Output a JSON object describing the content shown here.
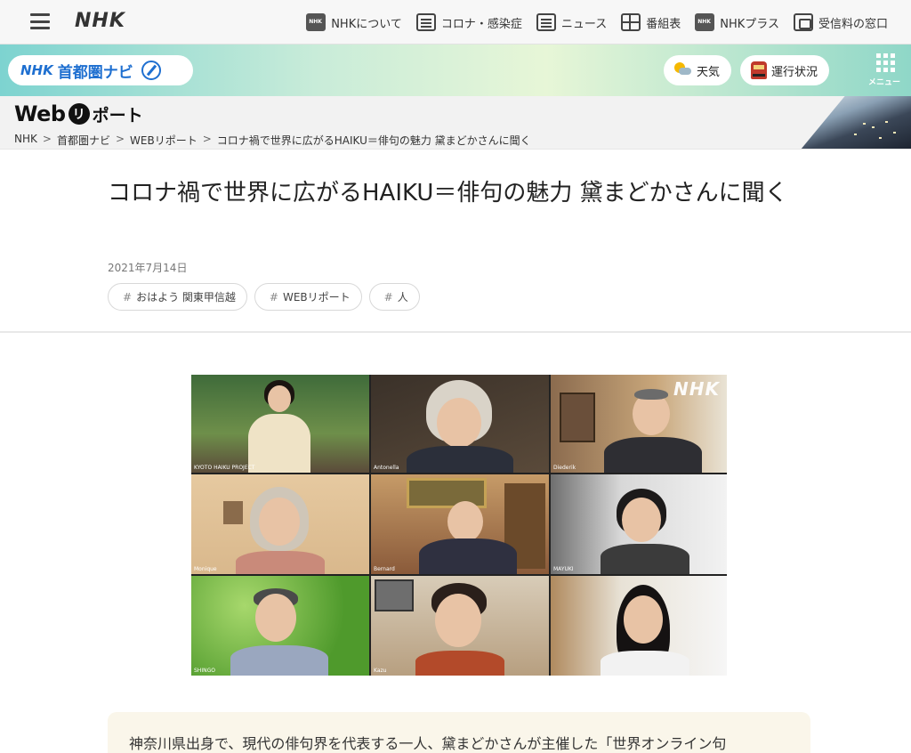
{
  "header": {
    "logo": "NHK",
    "nav": [
      {
        "label": "NHKについて",
        "icon": "nhk-about-icon"
      },
      {
        "label": "コロナ・感染症",
        "icon": "corona-icon"
      },
      {
        "label": "ニュース",
        "icon": "news-icon"
      },
      {
        "label": "番組表",
        "icon": "program-table-icon"
      },
      {
        "label": "NHKプラス",
        "icon": "nhk-plus-icon"
      },
      {
        "label": "受信料の窓口",
        "icon": "reception-fee-icon"
      }
    ]
  },
  "area_nav": {
    "brand": "NHK",
    "area_name": "首都圏ナビ",
    "weather_label": "天気",
    "traffic_label": "運行状況",
    "menu_label": "メニュー"
  },
  "section": {
    "logo_web": "Web",
    "logo_circle": "リ",
    "logo_rest": "ポート",
    "breadcrumb": [
      "NHK",
      "首都圏ナビ",
      "WEBリポート",
      "コロナ禍で世界に広がるHAIKU＝俳句の魅力 黛まどかさんに聞く"
    ],
    "breadcrumb_sep": ">"
  },
  "article": {
    "title": "コロナ禍で世界に広がるHAIKU＝俳句の魅力 黛まどかさんに聞く",
    "date": "2021年7月14日",
    "tags": [
      "おはよう 関東甲信越",
      "WEBリポート",
      "人"
    ],
    "tag_hash": "#",
    "photo_watermark": "NHK",
    "photo_participants": [
      "KYOTO HAIKU PROJECT",
      "Antonella",
      "Diederik",
      "Monique",
      "Bernard",
      "MAYUKI",
      "SHINGO",
      "Kazu",
      ""
    ],
    "intro_text": "神奈川県出身で、現代の俳句界を代表する一人、黛まどかさんが主催した「世界オンライン句"
  },
  "colors": {
    "brand_blue": "#1e6fd0",
    "area_gradient_start": "#7dd3d0",
    "intro_bg": "#faf6ea"
  }
}
